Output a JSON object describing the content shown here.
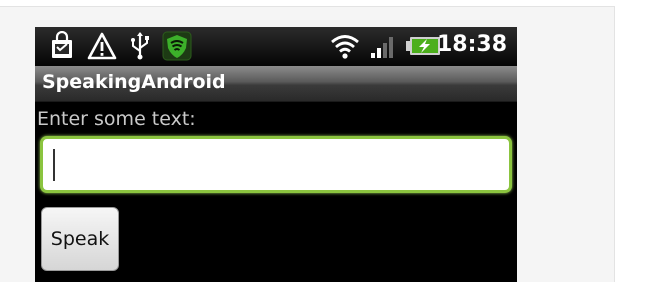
{
  "status_bar": {
    "time": "18:38",
    "icons": [
      "shopping-bag-icon",
      "warning-icon",
      "usb-icon",
      "shield-icon",
      "wifi-icon",
      "signal-icon",
      "battery-charging-icon"
    ]
  },
  "app": {
    "title": "SpeakingAndroid"
  },
  "form": {
    "label": "Enter some text:",
    "input_value": "",
    "speak_label": "Speak"
  },
  "colors": {
    "focus_border": "#8bc43f",
    "background": "#000000",
    "battery": "#4caf1c"
  }
}
